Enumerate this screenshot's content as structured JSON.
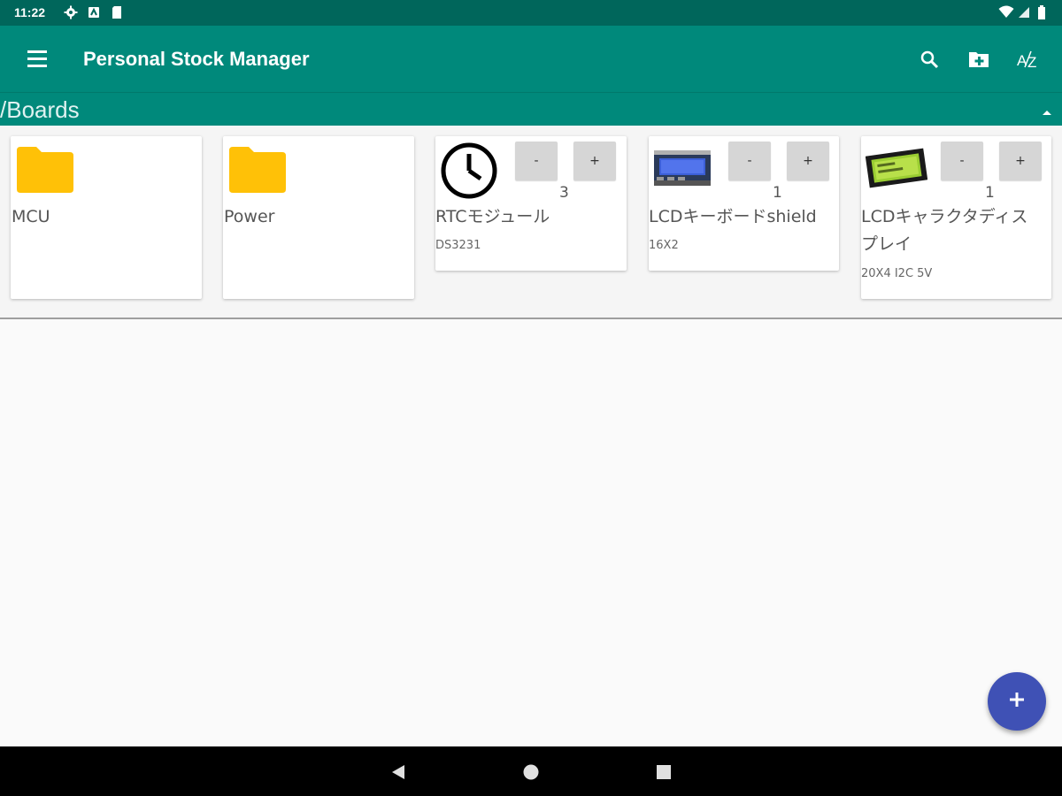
{
  "status_bar": {
    "time": "11:22",
    "icons": [
      "settings-icon",
      "app-notification-icon",
      "sd-card-icon"
    ],
    "right_icons": [
      "wifi-icon",
      "signal-icon",
      "battery-icon"
    ]
  },
  "app_bar": {
    "title": "Personal Stock Manager",
    "actions": [
      "search-icon",
      "create-folder-icon",
      "sort-az-icon"
    ],
    "color": "#00897b"
  },
  "path_bar": {
    "path": "/Boards"
  },
  "items": [
    {
      "type": "folder",
      "name": "MCU"
    },
    {
      "type": "folder",
      "name": "Power"
    },
    {
      "type": "item",
      "name": "RTCモジュール",
      "note": "DS3231",
      "quantity": "3",
      "icon": "clock-icon"
    },
    {
      "type": "item",
      "name": "LCDキーボードshield",
      "note": "16X2",
      "quantity": "1",
      "icon": "lcd-shield-image"
    },
    {
      "type": "item",
      "name_line1": "LCDキャラクタディス",
      "name_line2": "プレイ",
      "note": "20X4 I2C 5V",
      "quantity": "1",
      "icon": "lcd-display-image"
    }
  ],
  "qty_buttons": {
    "minus": "-",
    "plus": "+"
  },
  "fab": {
    "icon": "add-icon",
    "color": "#3f51b5"
  },
  "nav": [
    "back-icon",
    "home-icon",
    "recents-icon"
  ]
}
